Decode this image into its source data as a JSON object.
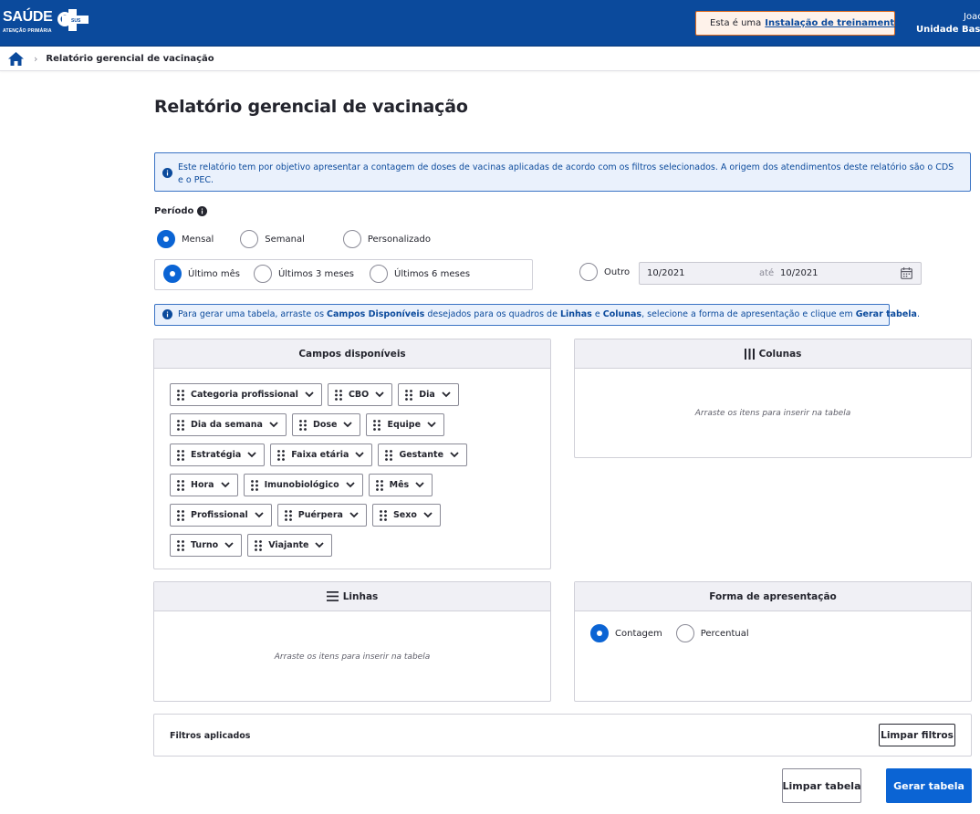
{
  "header": {
    "logo_text": "SAÚDE",
    "logo_mark": "SUS",
    "logo_subtitle": "ATENÇÃO PRIMÁRIA",
    "warning_prefix": "Esta é uma",
    "warning_link": "Instalação de treinamento",
    "user_name": "Joao C",
    "user_unit": "Unidade Basic"
  },
  "breadcrumb": {
    "home_icon": "home-icon",
    "current": "Relatório gerencial de vacinação"
  },
  "page": {
    "title": "Relatório gerencial de vacinação",
    "info_description": "Este relatório tem por objetivo apresentar a contagem de doses de vacinas aplicadas de acordo com os filtros selecionados. A origem dos atendimentos deste relatório são o CDS e o PEC."
  },
  "periodo": {
    "label": "Período",
    "type_options": [
      {
        "label": "Mensal",
        "selected": true
      },
      {
        "label": "Semanal",
        "selected": false
      },
      {
        "label": "Personalizado",
        "selected": false
      }
    ],
    "range_options": [
      {
        "label": "Último mês",
        "selected": true
      },
      {
        "label": "Últimos 3 meses",
        "selected": false
      },
      {
        "label": "Últimos 6 meses",
        "selected": false
      }
    ],
    "outro_label": "Outro",
    "date_from": "10/2021",
    "date_sep": "até",
    "date_to": "10/2021"
  },
  "instructions": {
    "p1": "Para gerar uma tabela, arraste os ",
    "b1": "Campos Disponíveis",
    "p2": " desejados para os quadros de ",
    "b2": "Linhas",
    "p3": " e ",
    "b3": "Colunas",
    "p4": ", selecione a forma de apresentação e clique em ",
    "b4": "Gerar tabela",
    "p5": "."
  },
  "campos": {
    "title": "Campos disponíveis",
    "rows": [
      [
        "Categoria profissional",
        "CBO",
        "Dia"
      ],
      [
        "Dia da semana",
        "Dose",
        "Equipe"
      ],
      [
        "Estratégia",
        "Faixa etária",
        "Gestante"
      ],
      [
        "Hora",
        "Imunobiológico",
        "Mês"
      ],
      [
        "Profissional",
        "Puérpera",
        "Sexo"
      ],
      [
        "Turno",
        "Viajante"
      ]
    ]
  },
  "colunas": {
    "title": "Colunas",
    "hint": "Arraste os itens para inserir na tabela"
  },
  "linhas": {
    "title": "Linhas",
    "hint": "Arraste os itens para inserir na tabela"
  },
  "forma": {
    "title": "Forma de apresentação",
    "options": [
      {
        "label": "Contagem",
        "selected": true
      },
      {
        "label": "Percentual",
        "selected": false
      }
    ]
  },
  "filtros": {
    "label": "Filtros aplicados",
    "clear_button": "Limpar filtros"
  },
  "actions": {
    "clear_table": "Limpar tabela",
    "generate_table": "Gerar tabela"
  },
  "colors": {
    "header_bg": "#0b4a9c",
    "primary": "#0b64d4",
    "warning_border": "#e06a1c",
    "info_bg": "#eaf1fc"
  }
}
